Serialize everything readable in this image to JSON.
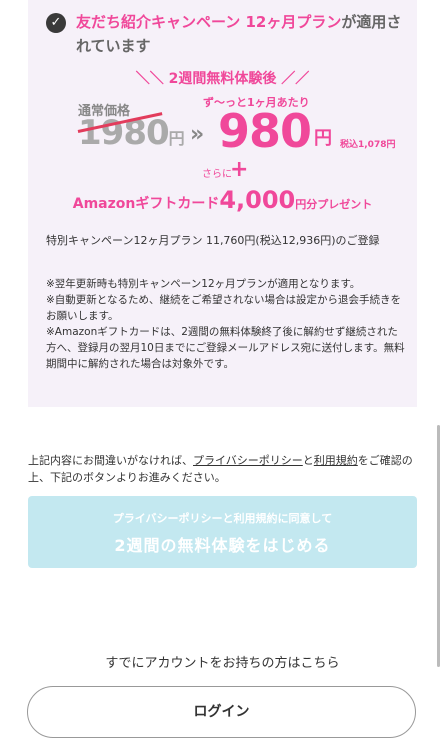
{
  "promo": {
    "applied_prefix": "友だち紹介キャンペーン 12ヶ月プラン",
    "applied_suffix": "が適用されています",
    "trial_banner": "＼＼ 2週間無料体験後 ／／",
    "regular_label": "通常価格",
    "regular_price": "1980",
    "regular_yen": "円",
    "arrow": "»",
    "monthly_label": "ず〜っと1ヶ月あたり",
    "sale_price": "980",
    "sale_yen": "円",
    "tax_included": "税込1,078円",
    "sarani": "さらに",
    "plus": "+",
    "gift_prefix": "Amazonギフトカード",
    "gift_amount": "4,000",
    "gift_suffix": "円分プレゼント",
    "plan_text": "特別キャンペーン12ヶ月プラン 11,760円(税込12,936円)のご登録",
    "notes": [
      "※翌年更新時も特別キャンペーン12ヶ月プランが適用となります。",
      "※自動更新となるため、継続をご希望されない場合は設定から退会手続きをお願いします。",
      "※Amazonギフトカードは、2週間の無料体験終了後に解約せず継続された方へ、登録月の翌月10日までにご登録メールアドレス宛に送付します。無料期間中に解約された場合は対象外です。"
    ]
  },
  "confirm": {
    "text_1": "上記内容にお間違いがなければ、",
    "privacy_link": "プライバシーポリシー",
    "text_2": "と",
    "terms_link": "利用規約",
    "text_3": "をご確認の上、下記のボタンよりお進みください。"
  },
  "trial_button": {
    "sub_label": "プライバシーポリシーと利用規約に同意して",
    "main_label": "2週間の無料体験をはじめる"
  },
  "account": {
    "text": "すでにアカウントをお持ちの方はこちら",
    "login_label": "ログイン"
  },
  "colors": {
    "accent_pink": "#f0489a",
    "button_disabled": "#c3e8f0",
    "card_background": "#f6f1f9"
  }
}
